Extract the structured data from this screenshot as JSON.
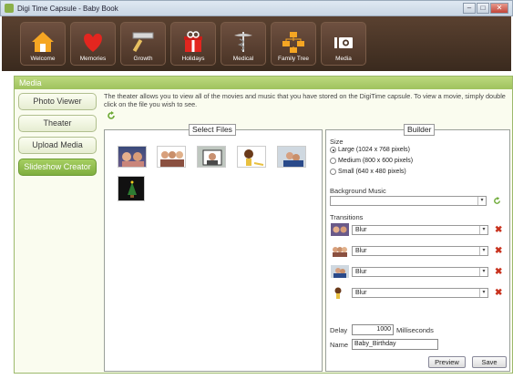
{
  "window": {
    "title": "Digi Time Capsule - Baby Book"
  },
  "toolbar": {
    "items": [
      {
        "label": "Welcome",
        "icon": "house-icon"
      },
      {
        "label": "Memories",
        "icon": "heart-icon"
      },
      {
        "label": "Growth",
        "icon": "ruler-icon"
      },
      {
        "label": "Holidays",
        "icon": "gift-icon"
      },
      {
        "label": "Medical",
        "icon": "caduceus-icon"
      },
      {
        "label": "Family Tree",
        "icon": "family-tree-icon"
      },
      {
        "label": "Media",
        "icon": "camera-icon"
      }
    ]
  },
  "panel": {
    "title": "Media",
    "description": "The theater allows you to view all of the movies and music that you have stored on the DigiTime capsule.  To view a movie, simply double click on the file you wish to see."
  },
  "sidenav": {
    "items": [
      {
        "label": "Photo Viewer",
        "active": false
      },
      {
        "label": "Theater",
        "active": false
      },
      {
        "label": "Upload Media",
        "active": false
      },
      {
        "label": "Slideshow Creator",
        "active": true
      }
    ]
  },
  "files": {
    "title": "Select Files"
  },
  "builder": {
    "title": "Builder",
    "size_label": "Size",
    "sizes": [
      {
        "label": "Large (1024 x 768 pixels)",
        "selected": true
      },
      {
        "label": "Medium (800 x 600 pixels)",
        "selected": false
      },
      {
        "label": "Small (640 x 480 pixels)",
        "selected": false
      }
    ],
    "background_music_label": "Background Music",
    "background_music_value": "",
    "transitions_label": "Transitions",
    "transitions": [
      {
        "value": "Blur"
      },
      {
        "value": "Blur"
      },
      {
        "value": "Blur"
      },
      {
        "value": "Blur"
      }
    ],
    "delay_label": "Delay",
    "delay_value": "1000",
    "delay_unit": "Milliseconds",
    "name_label": "Name",
    "name_value": "Baby_Birthday",
    "preview_label": "Preview",
    "save_label": "Save"
  },
  "colors": {
    "toolbar_bg": "#4a3426",
    "panel_accent": "#9fc25e",
    "active_nav": "#8cbf4a",
    "delete_red": "#c8321e"
  }
}
